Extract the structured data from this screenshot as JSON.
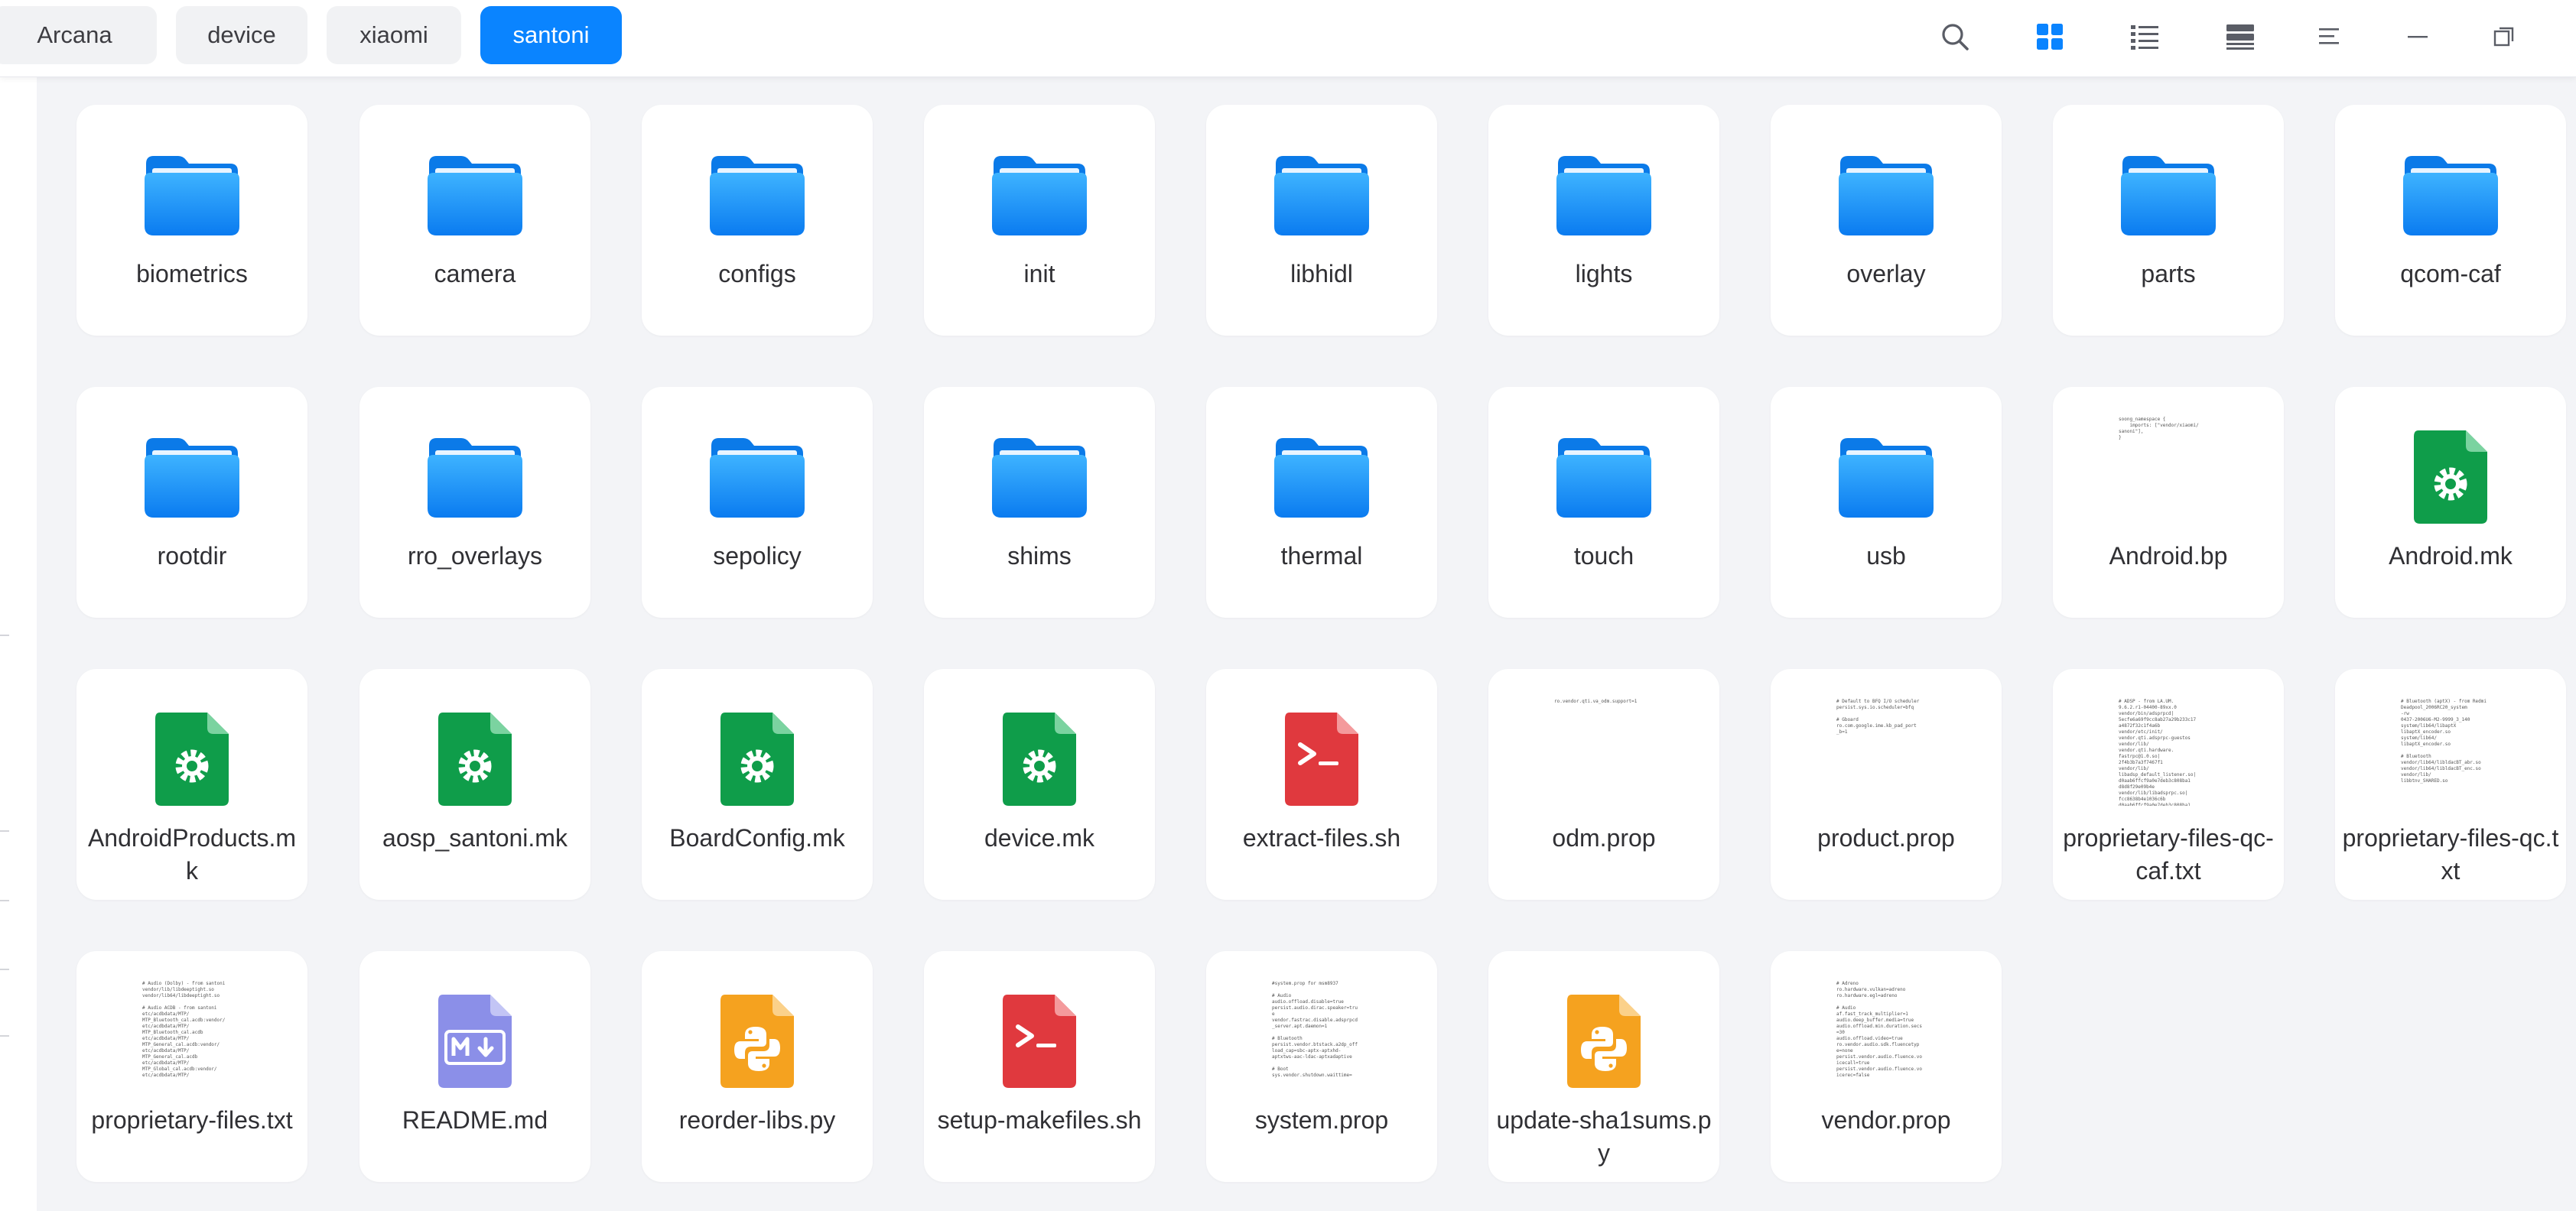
{
  "breadcrumbs": [
    "Arcana",
    "device",
    "xiaomi",
    "santoni"
  ],
  "accent_color": "#0a84ff",
  "toolbar": {
    "icons": [
      "search-icon",
      "icon-view-icon",
      "list-view-icon",
      "tree-view-icon",
      "menu-icon",
      "minimize-icon",
      "restore-icon"
    ]
  },
  "files": [
    {
      "name": "biometrics",
      "kind": "folder"
    },
    {
      "name": "camera",
      "kind": "folder"
    },
    {
      "name": "configs",
      "kind": "folder"
    },
    {
      "name": "init",
      "kind": "folder"
    },
    {
      "name": "libhidl",
      "kind": "folder"
    },
    {
      "name": "lights",
      "kind": "folder"
    },
    {
      "name": "overlay",
      "kind": "folder"
    },
    {
      "name": "parts",
      "kind": "folder"
    },
    {
      "name": "qcom-caf",
      "kind": "folder"
    },
    {
      "name": "rootdir",
      "kind": "folder"
    },
    {
      "name": "rro_overlays",
      "kind": "folder"
    },
    {
      "name": "sepolicy",
      "kind": "folder"
    },
    {
      "name": "shims",
      "kind": "folder"
    },
    {
      "name": "thermal",
      "kind": "folder"
    },
    {
      "name": "touch",
      "kind": "folder"
    },
    {
      "name": "usb",
      "kind": "folder"
    },
    {
      "name": "Android.bp",
      "kind": "text",
      "preview": "soong_namespace {\n    imports: [\"vendor/xiaomi/\nsanoni\"],\n}"
    },
    {
      "name": "Android.mk",
      "kind": "makefile"
    },
    {
      "name": "AndroidProducts.mk",
      "kind": "makefile"
    },
    {
      "name": "aosp_santoni.mk",
      "kind": "makefile"
    },
    {
      "name": "BoardConfig.mk",
      "kind": "makefile"
    },
    {
      "name": "device.mk",
      "kind": "makefile"
    },
    {
      "name": "extract-files.sh",
      "kind": "shell"
    },
    {
      "name": "odm.prop",
      "kind": "text",
      "preview": "ro.vendor.qti.va_odm.support=1"
    },
    {
      "name": "product.prop",
      "kind": "text",
      "preview": "# Default to BFQ I/O scheduler\npersist.sys.io.scheduler=bfq\n\n# Gboard\nro.com.google.ime.kb_pad_port\n_b=1"
    },
    {
      "name": "proprietary-files-qc-caf.txt",
      "kind": "text",
      "preview": "# ADSP - from LA.UM.\n9.6.2.r1-04400-89xx.0\nvendor/bin/adsprpcd|\n5ecfe6a69f9cc8ab27a29b233c17\na4872f32c1f4a6b\nvendor/etc/init/\nvendor.qti.adsprpc-guestos\nvendor/lib/\nvendor.qti.hardware.\nfastrpc@1.0.so|\n2f4b3b7a3f7467f1\nvendor/lib/\nlibadsp_default_listener.so|\nd0aab6ffcf9a0e7deb3c808ba1\nd8d8f29e09b4e\nvendor/lib/libadsprpc.so|\nfcc8638b4e1036c6b\nd0aab6ffcf9a0e7deb3c808ba1"
    },
    {
      "name": "proprietary-files-qc.txt",
      "kind": "text",
      "preview": "# Bluetooth (aptX) - from Redmi\nDeadpool_2006RC20_system\n-rw\n0437-2006U6-M2-9999_3_140\nsystem/lib64/libaptX\nlibaptX_encoder.so\nsystem/lib64/\nlibaptX_encoder.so\n\n# Bluetooth\nvendor/lib64/libldacBT_abr.so\nvendor/lib64/libldacBT_enc.so\nvendor/lib/\nlibbtnv_SHARED.so"
    },
    {
      "name": "proprietary-files.txt",
      "kind": "text",
      "preview": "# Audio (Dolby) - from santoni\nvendor/lib/libdeeptight.so\nvendor/lib64/libdeeptight.so\n\n# Audio ACDB - from santoni\netc/acdbdata/MTP/\nMTP_Bluetooth_cal.acdb:vendor/\netc/acdbdata/MTP/\nMTP_Bluetooth_cal.acdb\netc/acdbdata/MTP/\nMTP_General_cal.acdb:vendor/\netc/acdbdata/MTP/\nMTP_General_cal.acdb\netc/acdbdata/MTP/\nMTP_Global_cal.acdb:vendor/\netc/acdbdata/MTP/"
    },
    {
      "name": "README.md",
      "kind": "markdown"
    },
    {
      "name": "reorder-libs.py",
      "kind": "python"
    },
    {
      "name": "setup-makefiles.sh",
      "kind": "shell"
    },
    {
      "name": "system.prop",
      "kind": "text",
      "preview": "#system.prop for msm8937\n\n# Audio\naudio.offload.disable=true\npersist.audio.dirac.speaker=tru\ne\nvendor.fastrac.disable.adsprpcd\n_server.apt.daemon=1\n\n# Bluetooth\npersist.vendor.btstack.a2dp_off\nload_cap=sbc-aptx-aptxhd-\naptxtws-aac-ldac-aptxadaptive\n\n# Boot\nsys.vendor.shutdown.waittime="
    },
    {
      "name": "update-sha1sums.py",
      "kind": "python"
    },
    {
      "name": "vendor.prop",
      "kind": "text",
      "preview": "# Adreno\nro.hardware.vulkan=adreno\nro.hardware.egl=adreno\n\n# Audio\naf.fast_track_multiplier=1\naudio.deep_buffer.media=true\naudio.offload.min.duration.secs\n=30\naudio.offload.video=true\nro.vendor.audio.sdk.fluencetyp\ne=none\npersist.vendor.audio.fluence.vo\nicecall=true\npersist.vendor.audio.fluence.vo\nicerec=false"
    }
  ]
}
